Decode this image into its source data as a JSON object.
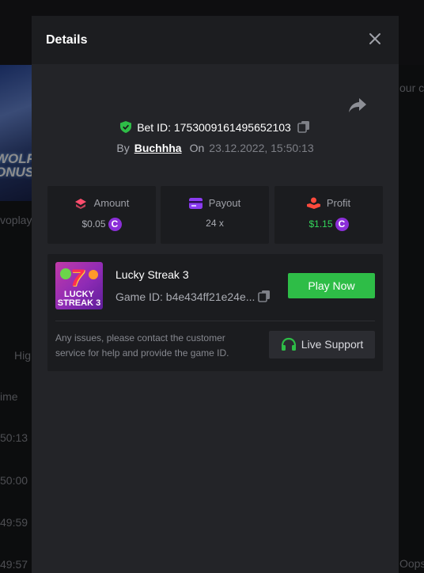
{
  "background": {
    "thumb_text": "WOLF\nONUS",
    "side_texts": [
      "voplay",
      "Hig",
      "ime",
      "50:13",
      "50:00",
      "49:59",
      "49:57"
    ],
    "right_texts": [
      "our c",
      "Oops"
    ]
  },
  "modal": {
    "title": "Details",
    "bet_id_label": "Bet ID: 1753009161495652103",
    "by_label": "By",
    "username": "Buchhha",
    "on_label": "On",
    "datetime": "23.12.2022, 15:50:13",
    "stats": {
      "amount": {
        "label": "Amount",
        "value": "$0.05"
      },
      "payout": {
        "label": "Payout",
        "value": "24 x"
      },
      "profit": {
        "label": "Profit",
        "value": "$1.15"
      }
    },
    "game": {
      "thumb_title": "LUCKY STREAK 3",
      "title": "Lucky Streak 3",
      "game_id": "Game ID: b4e434ff21e24e...",
      "play_label": "Play Now",
      "support_text": "Any issues, please contact the customer service for help and provide the game ID.",
      "support_label": "Live Support"
    }
  },
  "colors": {
    "accent_green": "#2ebd47",
    "profit_green": "#33d65a",
    "coin_purple": "#8b2fd8",
    "modal_bg": "#232428"
  },
  "icons": [
    "close-icon",
    "share-icon",
    "shield-check-icon",
    "copy-icon",
    "amount-icon",
    "payout-card-icon",
    "profit-hand-icon",
    "coin-icon",
    "headset-icon"
  ]
}
